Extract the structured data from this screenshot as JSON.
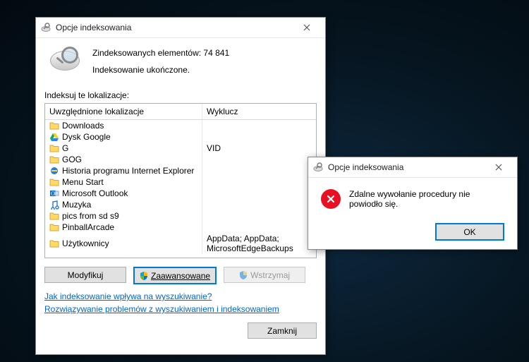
{
  "main": {
    "title": "Opcje indeksowania",
    "status_line1": "Zindeksowanych elementów: 74 841",
    "status_line2": "Indeksowanie ukończone.",
    "section_label": "Indeksuj te lokalizacje:",
    "col_included": "Uwzględnione lokalizacje",
    "col_exclude": "Wyklucz",
    "rows": [
      {
        "icon": "folder",
        "name": "Downloads",
        "exclude": ""
      },
      {
        "icon": "gdrive",
        "name": "Dysk Google",
        "exclude": ""
      },
      {
        "icon": "folder",
        "name": "G",
        "exclude": "VID"
      },
      {
        "icon": "folder",
        "name": "GOG",
        "exclude": ""
      },
      {
        "icon": "ie",
        "name": "Historia programu Internet Explorer",
        "exclude": ""
      },
      {
        "icon": "folder",
        "name": "Menu Start",
        "exclude": ""
      },
      {
        "icon": "outlook",
        "name": "Microsoft Outlook",
        "exclude": ""
      },
      {
        "icon": "music",
        "name": "Muzyka",
        "exclude": ""
      },
      {
        "icon": "folder",
        "name": "pics from sd s9",
        "exclude": ""
      },
      {
        "icon": "folder",
        "name": "PinballArcade",
        "exclude": ""
      },
      {
        "icon": "folder",
        "name": "Użytkownicy",
        "exclude": "AppData; AppData; MicrosoftEdgeBackups"
      }
    ],
    "btn_modify": "Modyfikuj",
    "btn_advanced": "Zaawansowane",
    "btn_pause": "Wstrzymaj",
    "link1": "Jak indeksowanie wpływa na wyszukiwanie?",
    "link2": "Rozwiązywanie problemów z wyszukiwaniem i indeksowaniem",
    "btn_close": "Zamknij"
  },
  "error": {
    "title": "Opcje indeksowania",
    "message": "Zdalne wywołanie procedury nie powiodło się.",
    "ok": "OK"
  }
}
